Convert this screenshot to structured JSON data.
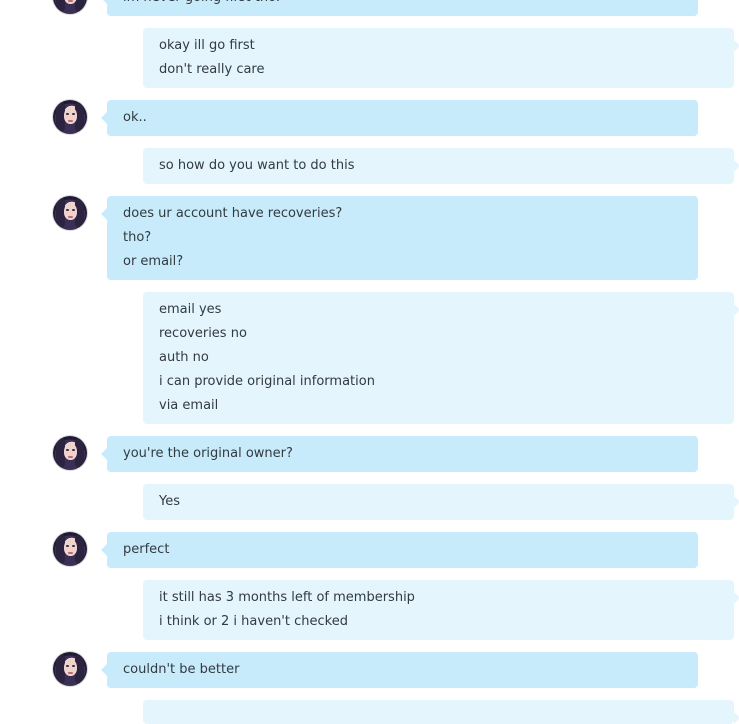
{
  "messages": [
    {
      "from": "them",
      "lines": [
        "im never going first tho."
      ]
    },
    {
      "from": "me",
      "lines": [
        "okay ill go first",
        "don't really care"
      ]
    },
    {
      "from": "them",
      "lines": [
        "ok.."
      ]
    },
    {
      "from": "me",
      "lines": [
        "so how do you want to do this"
      ]
    },
    {
      "from": "them",
      "lines": [
        "does ur account have recoveries?",
        "tho?",
        "or email?"
      ]
    },
    {
      "from": "me",
      "lines": [
        "email yes",
        "recoveries no",
        "auth no",
        "i can provide original information",
        "via email"
      ]
    },
    {
      "from": "them",
      "lines": [
        "you're the original owner?"
      ]
    },
    {
      "from": "me",
      "lines": [
        "Yes"
      ]
    },
    {
      "from": "them",
      "lines": [
        "perfect"
      ]
    },
    {
      "from": "me",
      "lines": [
        "it still has 3 months left of membership",
        "i think or 2 i haven't checked"
      ]
    },
    {
      "from": "them",
      "lines": [
        "couldn't be better"
      ]
    },
    {
      "from": "me",
      "lines": []
    }
  ],
  "colors": {
    "incoming_bubble": "#c7ebfb",
    "outgoing_bubble": "#e4f5fd",
    "text": "#333a40"
  }
}
